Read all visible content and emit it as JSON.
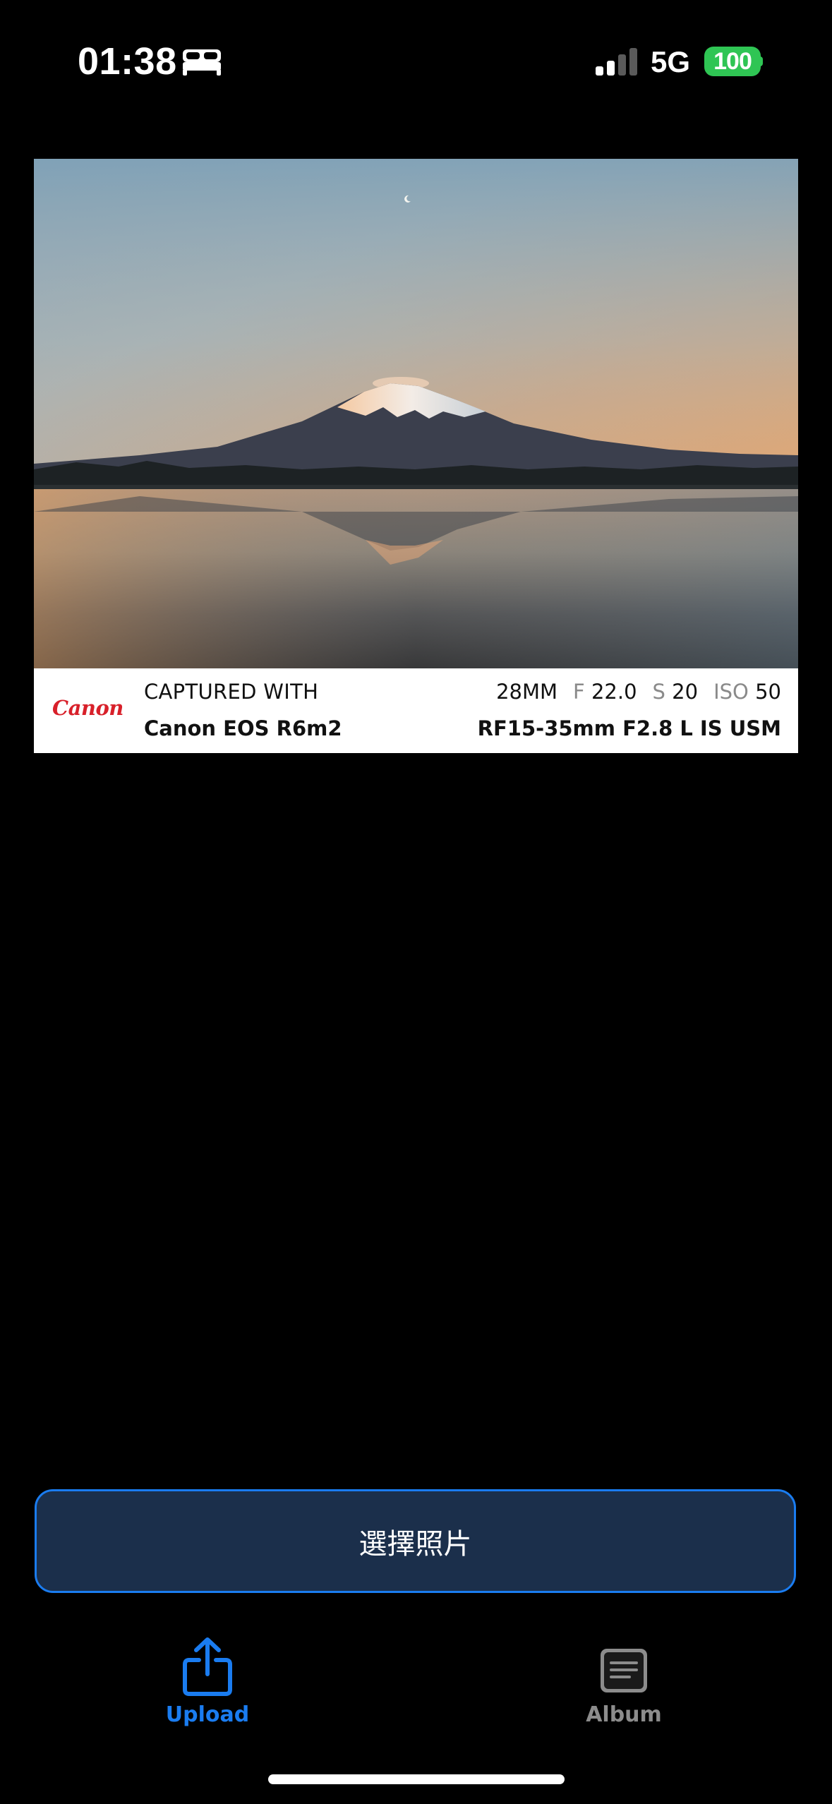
{
  "status_bar": {
    "time": "01:38",
    "sleep_icon": "bed-icon",
    "signal_icon": "cellular-signal-icon",
    "network": "5G",
    "battery": "100",
    "battery_color": "#2fc554"
  },
  "photo_card": {
    "photo_description_icon": "landscape-photo",
    "brand_logo_text": "Canon",
    "brand_color": "#d8202a",
    "caption": "CAPTURED WITH",
    "camera_model": "Canon EOS R6m2",
    "focal_length": "28MM",
    "aperture_label": "F",
    "aperture_value": "22.0",
    "shutter_label": "S",
    "shutter_value": "20",
    "iso_label": "ISO",
    "iso_value": "50",
    "lens": "RF15-35mm F2.8 L IS USM"
  },
  "select_button": {
    "label": "選擇照片",
    "background": "#1b2f4b",
    "border_color": "#1a7cf0"
  },
  "tab_bar": {
    "tabs": [
      {
        "label": "Upload",
        "icon": "share-upload-icon",
        "active": true,
        "color": "#1a7cf0"
      },
      {
        "label": "Album",
        "icon": "album-list-icon",
        "active": false,
        "color": "#8c8c8c"
      }
    ]
  }
}
